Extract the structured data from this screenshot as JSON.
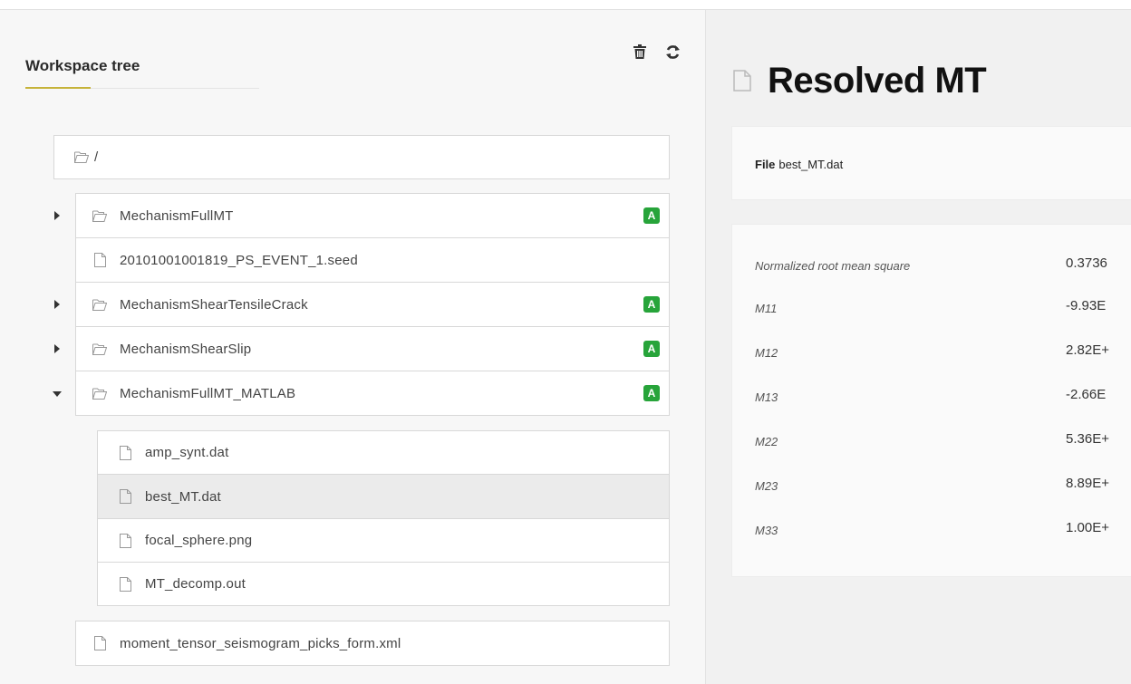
{
  "workspace": {
    "title": "Workspace tree",
    "root_path": "/"
  },
  "tree": {
    "items": [
      {
        "name": "MechanismFullMT",
        "type": "folder",
        "badge": "A"
      },
      {
        "name": "20101001001819_PS_EVENT_1.seed",
        "type": "file"
      },
      {
        "name": "MechanismShearTensileCrack",
        "type": "folder",
        "badge": "A"
      },
      {
        "name": "MechanismShearSlip",
        "type": "folder",
        "badge": "A"
      },
      {
        "name": "MechanismFullMT_MATLAB",
        "type": "folder",
        "badge": "A",
        "expanded": true
      }
    ],
    "children": [
      {
        "name": "amp_synt.dat"
      },
      {
        "name": "best_MT.dat",
        "selected": true
      },
      {
        "name": "focal_sphere.png"
      },
      {
        "name": "MT_decomp.out"
      }
    ],
    "bottom_file": "moment_tensor_seismogram_picks_form.xml"
  },
  "detail": {
    "title": "Resolved MT",
    "file_label": "File",
    "file_name": "best_MT.dat",
    "rows": [
      {
        "key": "Normalized root mean square",
        "value": "0.3736"
      },
      {
        "key": "M11",
        "value": "-9.93E"
      },
      {
        "key": "M12",
        "value": "2.82E+"
      },
      {
        "key": "M13",
        "value": "-2.66E"
      },
      {
        "key": "M22",
        "value": "5.36E+"
      },
      {
        "key": "M23",
        "value": "8.89E+"
      },
      {
        "key": "M33",
        "value": "1.00E+"
      }
    ]
  },
  "colors": {
    "badge_green": "#27a43a",
    "accent_underline": "#c6b33a",
    "selected_row": "#ebebeb"
  },
  "icons": [
    "trash-icon",
    "refresh-icon",
    "folder-icon",
    "file-icon",
    "caret-right-icon",
    "caret-down-icon"
  ]
}
